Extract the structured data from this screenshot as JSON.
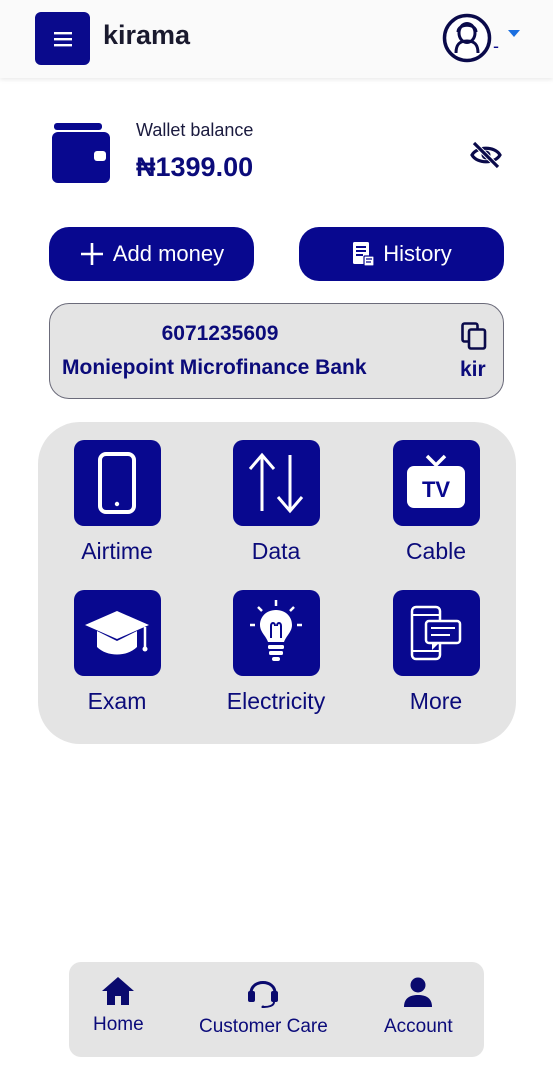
{
  "header": {
    "brand": "kirama",
    "avatar_suffix": "-"
  },
  "wallet": {
    "label": "Wallet balance",
    "balance": "₦1399.00"
  },
  "actions": {
    "add_money": "Add money",
    "history": "History"
  },
  "account": {
    "number": "6071235609",
    "bank": "Moniepoint Microfinance Bank",
    "name": "kir"
  },
  "services": [
    {
      "label": "Airtime",
      "icon": "phone-icon"
    },
    {
      "label": "Data",
      "icon": "data-transfer-icon"
    },
    {
      "label": "Cable",
      "icon": "tv-icon"
    },
    {
      "label": "Exam",
      "icon": "graduation-cap-icon"
    },
    {
      "label": "Electricity",
      "icon": "lightbulb-icon"
    },
    {
      "label": "More",
      "icon": "chat-phone-icon"
    }
  ],
  "bottom_nav": {
    "home": "Home",
    "customer_care": "Customer Care",
    "account": "Account"
  },
  "colors": {
    "primary": "#08088f",
    "text": "#0b0b7a",
    "card_bg": "#e4e4e4",
    "caret": "#1a6fe0"
  }
}
